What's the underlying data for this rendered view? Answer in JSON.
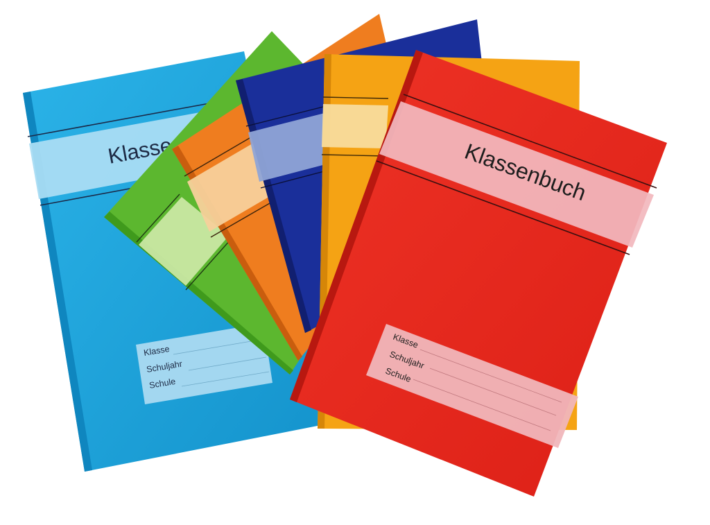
{
  "colors": {
    "light_blue": "#1aa3db",
    "green": "#5cb72f",
    "orange": "#ef7d1f",
    "dark_blue": "#1a2f9a",
    "yellow_orange": "#f5a314",
    "red": "#e8291f"
  },
  "books": [
    {
      "color_name": "light_blue",
      "cover": {
        "title": "Klasse",
        "fields": {
          "klasse": "Klasse",
          "schuljahr": "Schuljahr",
          "schule": "Schule"
        }
      }
    },
    {
      "color_name": "green"
    },
    {
      "color_name": "orange"
    },
    {
      "color_name": "dark_blue"
    },
    {
      "color_name": "yellow_orange"
    },
    {
      "color_name": "red",
      "cover": {
        "title": "Klassenbuch",
        "fields": {
          "klasse": "Klasse",
          "schuljahr": "Schuljahr",
          "schule": "Schule"
        }
      }
    }
  ]
}
